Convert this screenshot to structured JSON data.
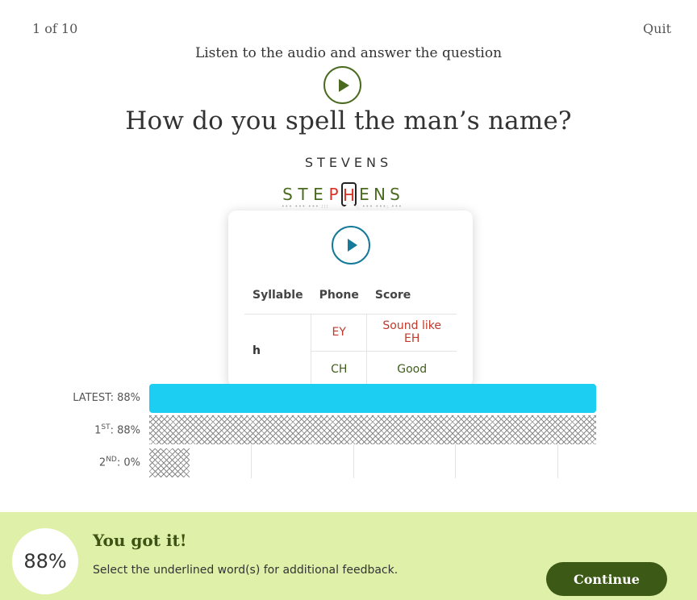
{
  "header": {
    "progress": "1 of 10",
    "quit_label": "Quit"
  },
  "prompt": {
    "instruction": "Listen to the audio and answer the question",
    "question": "How do you spell the man’s name?"
  },
  "answer": {
    "target_word": "STEVENS",
    "spoken_letters": [
      {
        "char": "S",
        "status": "good"
      },
      {
        "char": "T",
        "status": "good"
      },
      {
        "char": "E",
        "status": "good"
      },
      {
        "char": "P",
        "status": "bad"
      },
      {
        "char": "H",
        "status": "bad"
      },
      {
        "char": "E",
        "status": "good"
      },
      {
        "char": "N",
        "status": "good"
      },
      {
        "char": "S",
        "status": "good"
      }
    ],
    "selected_letter_index": 4
  },
  "popover": {
    "headers": [
      "Syllable",
      "Phone",
      "Score"
    ],
    "syllable": "h",
    "rows": [
      {
        "phone": "EY",
        "score": "Sound like EH",
        "status": "bad"
      },
      {
        "phone": "CH",
        "score": "Good",
        "status": "good"
      }
    ]
  },
  "chart_data": {
    "type": "bar",
    "orientation": "horizontal",
    "xlim": [
      0,
      100
    ],
    "bars": [
      {
        "label": "LATEST: 88%",
        "value": 88,
        "style": "solid",
        "color": "#1ccff2"
      },
      {
        "label_main": "1",
        "label_sup": "ST",
        "label_rest": ": 88%",
        "value": 88,
        "style": "hatched"
      },
      {
        "label_main": "2",
        "label_sup": "ND",
        "label_rest": ": 0%",
        "value": 0,
        "style": "hatched"
      }
    ]
  },
  "footer": {
    "score": "88%",
    "title": "You got it!",
    "subtitle": "Select the underlined word(s) for additional feedback.",
    "continue_label": "Continue"
  },
  "colors": {
    "accent_green": "#4a6b1f",
    "error_red": "#d93025",
    "bar_blue": "#1ccff2",
    "footer_bg": "#dff0a9",
    "button_bg": "#3c5a16"
  }
}
